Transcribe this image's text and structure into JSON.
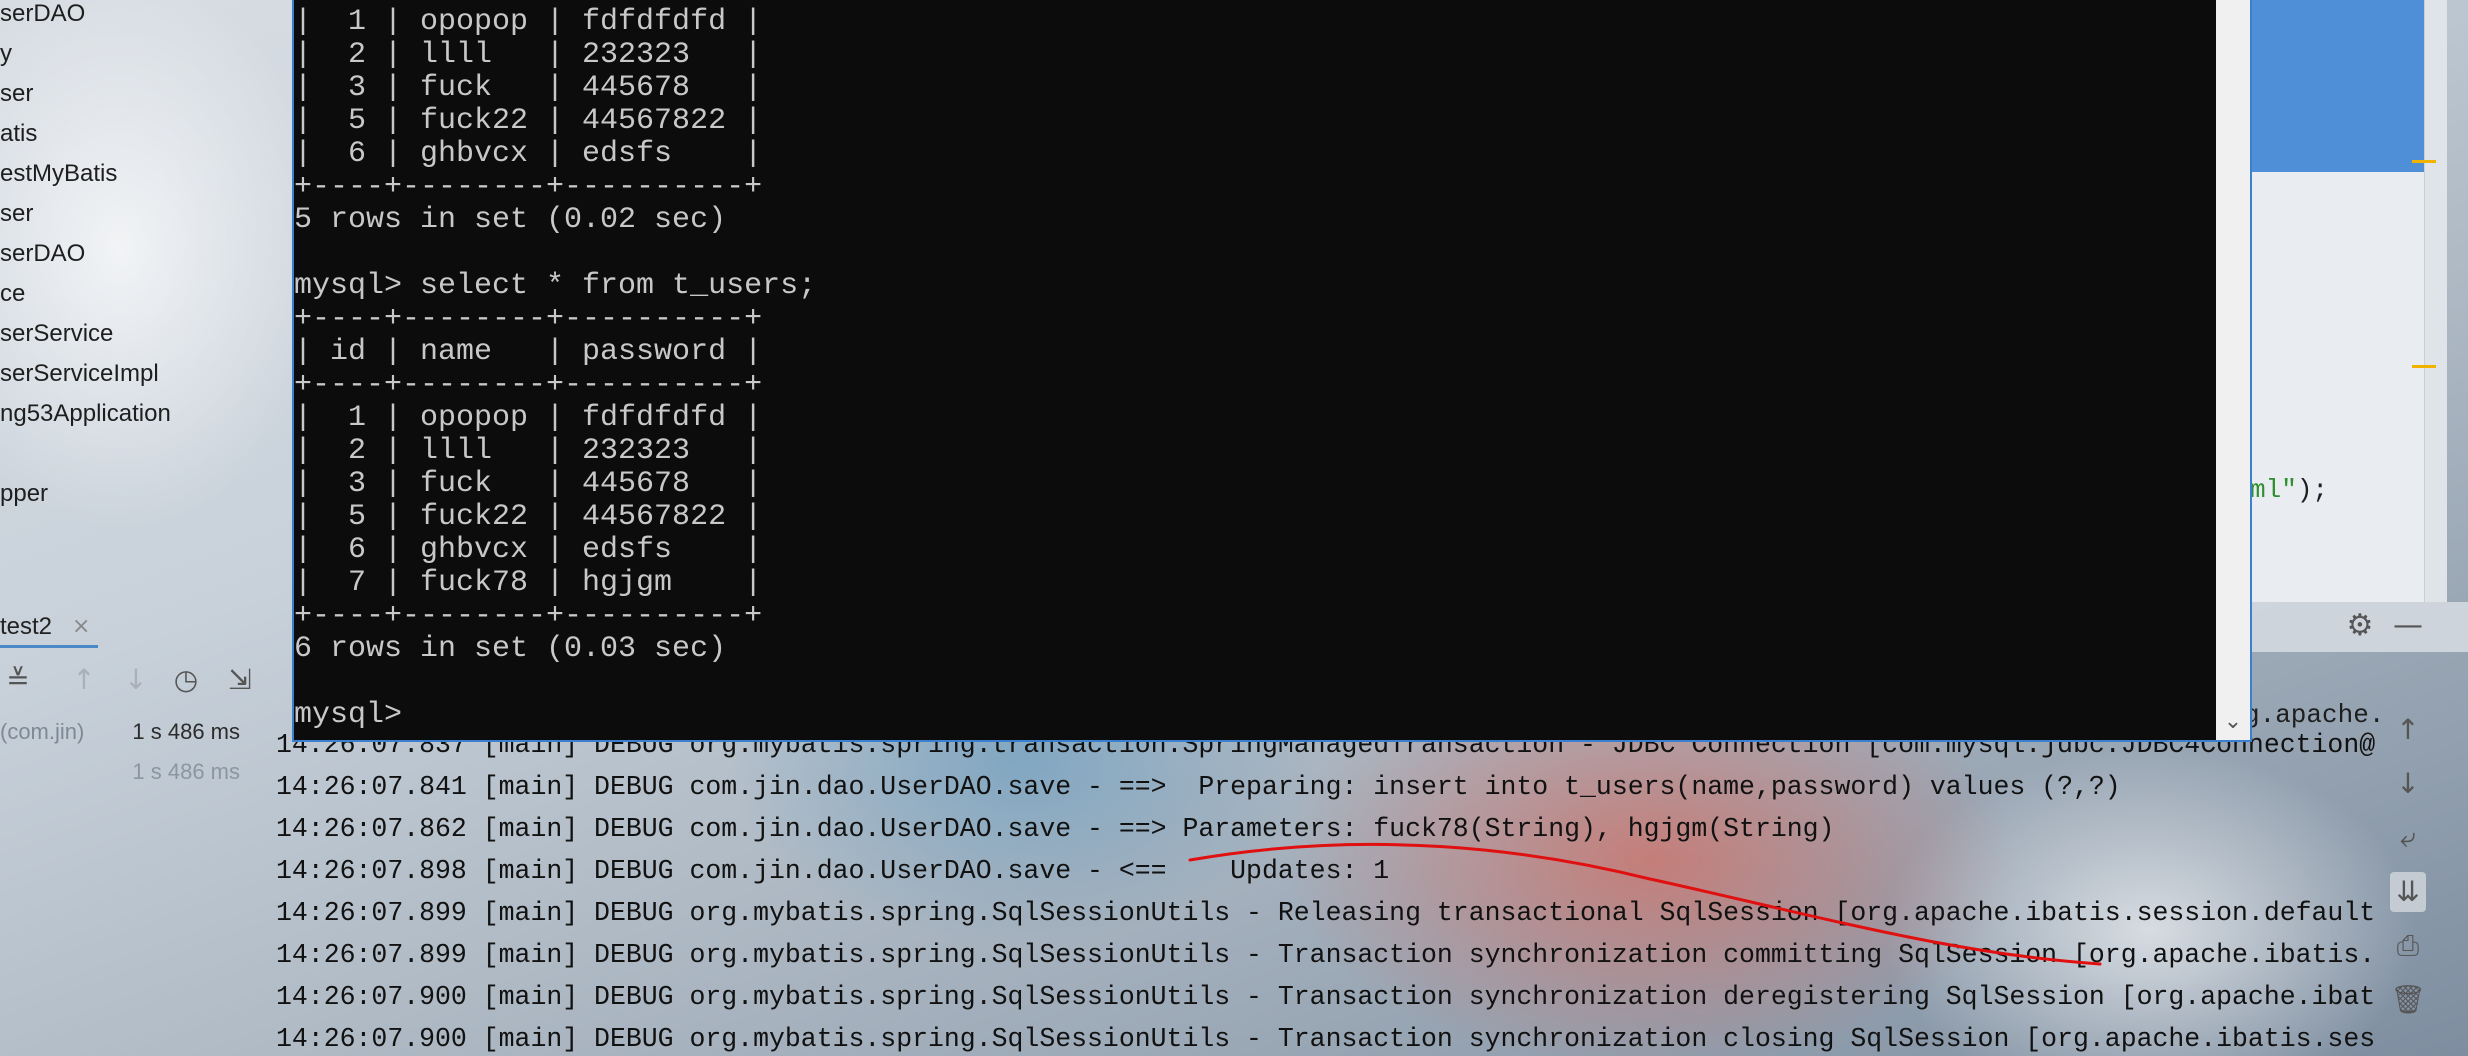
{
  "project_tree": {
    "items": [
      "serDAO",
      "y",
      "ser",
      "atis",
      "estMyBatis",
      "ser",
      "serDAO",
      "ce",
      "serService",
      "serServiceImpl",
      "ng53Application",
      "",
      "pper"
    ]
  },
  "run_panel": {
    "tab_label": "test2",
    "tab_close": "×",
    "tests": [
      {
        "name": "(com.jin)",
        "time": "1 s 486 ms"
      },
      {
        "name": "",
        "time": "1 s 486 ms"
      }
    ]
  },
  "editor": {
    "code_fragment_string": "ml\"",
    "code_fragment_rest": ");",
    "console_peek": "g.apache.i"
  },
  "terminal": {
    "lines": [
      "|  1 | opopop | fdfdfdfd |",
      "|  2 | llll   | 232323   |",
      "|  3 | fuck   | 445678   |",
      "|  5 | fuck22 | 44567822 |",
      "|  6 | ghbvcx | edsfs    |",
      "+----+--------+----------+",
      "5 rows in set (0.02 sec)",
      "",
      "mysql> select * from t_users;",
      "+----+--------+----------+",
      "| id | name   | password |",
      "+----+--------+----------+",
      "|  1 | opopop | fdfdfdfd |",
      "|  2 | llll   | 232323   |",
      "|  3 | fuck   | 445678   |",
      "|  5 | fuck22 | 44567822 |",
      "|  6 | ghbvcx | edsfs    |",
      "|  7 | fuck78 | hgjgm    |",
      "+----+--------+----------+",
      "6 rows in set (0.03 sec)",
      "",
      "mysql>"
    ]
  },
  "console_log": {
    "lines": [
      "14:26:07.837 [main] DEBUG org.mybatis.spring.transaction.SpringManagedTransaction - JDBC Connection [com.mysql.jdbc.JDBC4Connection@",
      "14:26:07.841 [main] DEBUG com.jin.dao.UserDAO.save - ==>  Preparing: insert into t_users(name,password) values (?,?)",
      "14:26:07.862 [main] DEBUG com.jin.dao.UserDAO.save - ==> Parameters: fuck78(String), hgjgm(String)",
      "14:26:07.898 [main] DEBUG com.jin.dao.UserDAO.save - <==    Updates: 1",
      "14:26:07.899 [main] DEBUG org.mybatis.spring.SqlSessionUtils - Releasing transactional SqlSession [org.apache.ibatis.session.default",
      "14:26:07.899 [main] DEBUG org.mybatis.spring.SqlSessionUtils - Transaction synchronization committing SqlSession [org.apache.ibatis.",
      "14:26:07.900 [main] DEBUG org.mybatis.spring.SqlSessionUtils - Transaction synchronization deregistering SqlSession [org.apache.ibat",
      "14:26:07.900 [main] DEBUG org.mybatis.spring.SqlSessionUtils - Transaction synchronization closing SqlSession [org.apache.ibatis.ses"
    ]
  },
  "icons": {
    "collapse": "≚",
    "up": "↑",
    "down": "↓",
    "history": "◷",
    "export": "⇲",
    "gear": "⚙",
    "minimize": "—",
    "soft_wrap": "⤶",
    "scroll_end": "⇊",
    "print": "⎙",
    "trash": "🗑",
    "chevron_down": "⌄"
  },
  "colors": {
    "terminal_bg": "#0c0c0c",
    "terminal_text": "#c8c8c8",
    "annotation": "#e01010",
    "accent_blue": "#3a7fd0"
  }
}
